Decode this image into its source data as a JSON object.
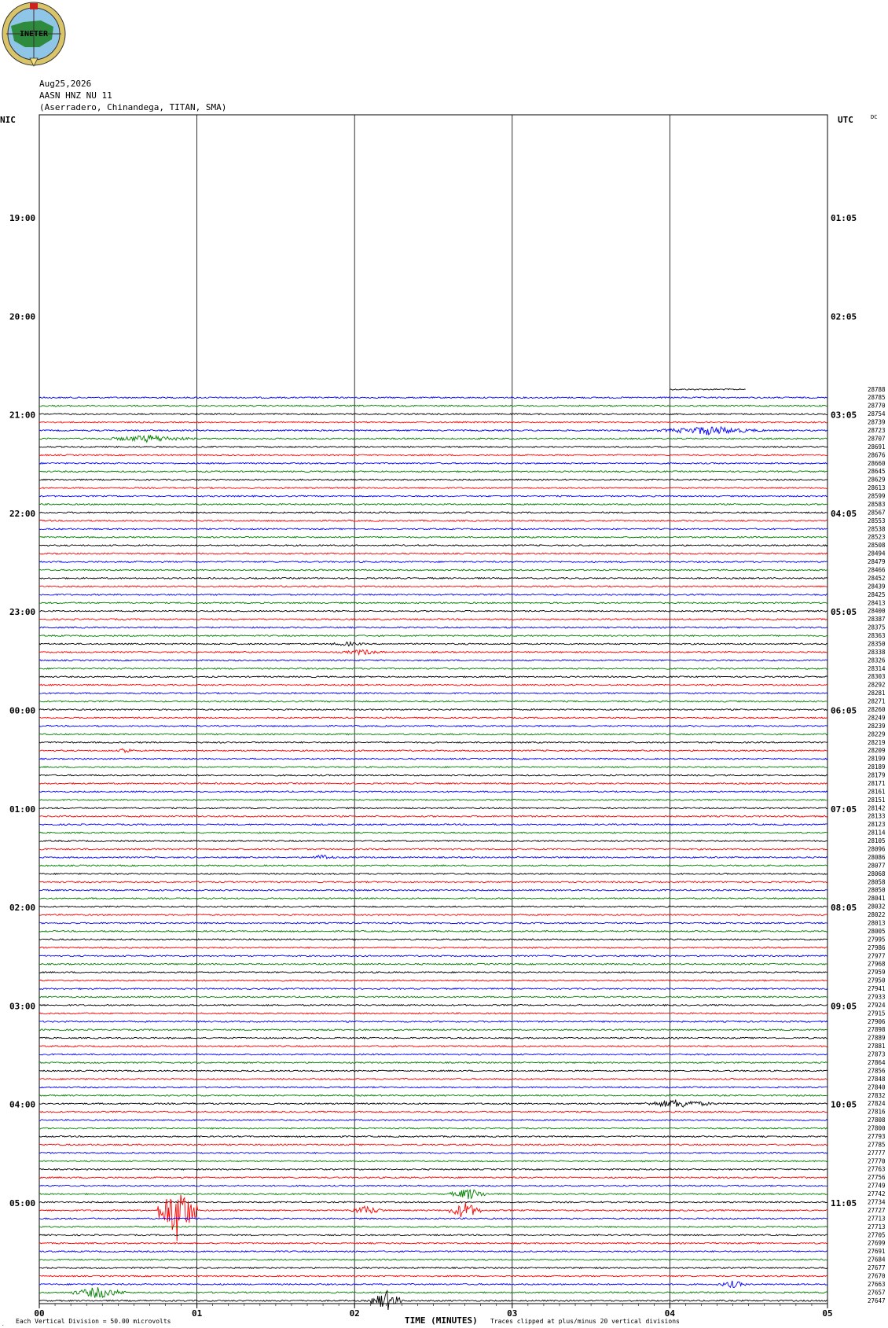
{
  "logo": {
    "text": "INETER",
    "color_ring": "#d9c46a",
    "color_map": "#2e8b3e",
    "color_sea": "#8fc6e8"
  },
  "header": {
    "date": "Aug25,2026",
    "channel": "AASN HNZ NU 11",
    "location": "(Aserradero, Chinandega, TITAN, SMA)",
    "left_tz": "NIC",
    "right_tz": "UTC",
    "dc": "DC"
  },
  "footer": {
    "scale": "Each Vertical Division =    50.00 microvolts",
    "xlabel": "TIME (MINUTES)",
    "clip_note": "Traces clipped at plus/minus 20 vertical divisions"
  },
  "chart_data": {
    "type": "line",
    "title": "",
    "xlabel": "TIME (MINUTES)",
    "xlim": [
      0,
      5
    ],
    "x_ticks": [
      "00",
      "01",
      "02",
      "03",
      "04",
      "05"
    ],
    "grid": true,
    "trace_colors": [
      "#ff0000",
      "#0000ff",
      "#008000",
      "#000000"
    ],
    "left_hour_labels": [
      "19:00",
      "20:00",
      "21:00",
      "22:00",
      "23:00",
      "00:00",
      "01:00",
      "02:00",
      "03:00",
      "04:00",
      "05:00"
    ],
    "right_hour_labels": [
      "01:05",
      "02:05",
      "03:05",
      "04:05",
      "05:05",
      "06:05",
      "07:05",
      "08:05",
      "09:05",
      "10:05",
      "11:05"
    ],
    "first_trace_start_minute": 4.0,
    "traces_per_hour": 12,
    "trace_counts": [
      "28788",
      "28785",
      "28770",
      "28754",
      "28739",
      "28723",
      "28707",
      "28691",
      "28676",
      "28660",
      "28645",
      "28629",
      "28613",
      "28599",
      "28583",
      "28567",
      "28553",
      "28538",
      "28523",
      "28508",
      "28494",
      "28479",
      "28466",
      "28452",
      "28439",
      "28425",
      "28413",
      "28400",
      "28387",
      "28375",
      "28363",
      "28350",
      "28338",
      "28326",
      "28314",
      "28303",
      "28292",
      "28281",
      "28271",
      "28260",
      "28249",
      "28239",
      "28229",
      "28219",
      "28209",
      "28199",
      "28189",
      "28179",
      "28171",
      "28161",
      "28151",
      "28142",
      "28133",
      "28123",
      "28114",
      "28105",
      "28096",
      "28086",
      "28077",
      "28068",
      "28058",
      "28050",
      "28041",
      "28032",
      "28022",
      "28013",
      "28005",
      "27995",
      "27986",
      "27977",
      "27968",
      "27959",
      "27950",
      "27941",
      "27933",
      "27924",
      "27915",
      "27906",
      "27898",
      "27889",
      "27881",
      "27873",
      "27864",
      "27856",
      "27848",
      "27840",
      "27832",
      "27824",
      "27816",
      "27808",
      "27800",
      "27793",
      "27785",
      "27777",
      "27770",
      "27763",
      "27756",
      "27749",
      "27742",
      "27734",
      "27727",
      "27713",
      "27713",
      "27705",
      "27699",
      "27691",
      "27684",
      "27677",
      "27670",
      "27663",
      "27657",
      "27647"
    ],
    "events": [
      {
        "trace": 5,
        "start": 3.9,
        "end": 4.6,
        "amp": 6
      },
      {
        "trace": 6,
        "start": 0.4,
        "end": 1.0,
        "amp": 5
      },
      {
        "trace": 31,
        "start": 1.8,
        "end": 2.1,
        "amp": 3
      },
      {
        "trace": 32,
        "start": 1.9,
        "end": 2.2,
        "amp": 4
      },
      {
        "trace": 44,
        "start": 0.5,
        "end": 0.6,
        "amp": 5
      },
      {
        "trace": 57,
        "start": 1.7,
        "end": 1.9,
        "amp": 4
      },
      {
        "trace": 87,
        "start": 3.8,
        "end": 4.3,
        "amp": 6
      },
      {
        "trace": 98,
        "start": 2.6,
        "end": 2.85,
        "amp": 8
      },
      {
        "trace": 100,
        "start": 0.75,
        "end": 1.0,
        "amp": 40
      },
      {
        "trace": 100,
        "start": 1.95,
        "end": 2.2,
        "amp": 6
      },
      {
        "trace": 100,
        "start": 2.6,
        "end": 2.8,
        "amp": 12
      },
      {
        "trace": 109,
        "start": 4.3,
        "end": 4.5,
        "amp": 5
      },
      {
        "trace": 110,
        "start": 0.2,
        "end": 0.55,
        "amp": 8
      },
      {
        "trace": 111,
        "start": 2.1,
        "end": 2.3,
        "amp": 14
      }
    ]
  }
}
